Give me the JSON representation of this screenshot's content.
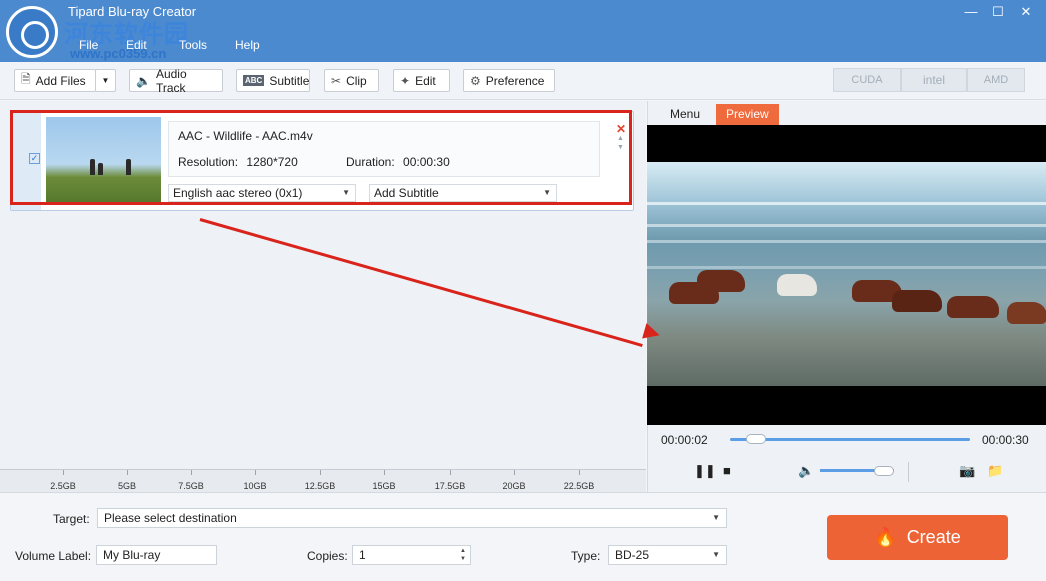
{
  "app": {
    "title": "Tipard Blu-ray Creator",
    "watermark": "河东软件园",
    "watermark_url": "www.pc0359.cn",
    "menu": [
      "File",
      "Edit",
      "Tools",
      "Help"
    ],
    "window_controls": {
      "minimize": "—",
      "maximize": "☐",
      "close": "✕"
    }
  },
  "toolbar": {
    "add_files": "Add Files",
    "audio_track": "Audio Track",
    "subtitle": "Subtitle",
    "clip": "Clip",
    "edit": "Edit",
    "preference": "Preference",
    "gpu": [
      "CUDA",
      "intel",
      "AMD"
    ]
  },
  "file": {
    "name": "AAC - Wildlife - AAC.m4v",
    "resolution_label": "Resolution:",
    "resolution": "1280*720",
    "duration_label": "Duration:",
    "duration": "00:00:30",
    "audio": "English aac stereo (0x1)",
    "subtitle": "Add Subtitle",
    "checked": true
  },
  "capacity": {
    "labels": [
      "2.5GB",
      "5GB",
      "7.5GB",
      "10GB",
      "12.5GB",
      "15GB",
      "17.5GB",
      "20GB",
      "22.5GB"
    ]
  },
  "preview": {
    "tabs": [
      "Menu",
      "Preview"
    ],
    "active_tab": "Preview",
    "current_time": "00:00:02",
    "total_time": "00:00:30",
    "progress_fraction": 0.067
  },
  "bottom": {
    "target_label": "Target:",
    "target_value": "Please select destination",
    "volume_label_label": "Volume Label:",
    "volume_label_value": "My Blu-ray",
    "copies_label": "Copies:",
    "copies_value": "1",
    "type_label": "Type:",
    "type_value": "BD-25",
    "create_label": "Create"
  },
  "colors": {
    "title_bar": "#4c8ad0",
    "accent": "#ee6336",
    "highlight_annotation": "#d9241c"
  }
}
